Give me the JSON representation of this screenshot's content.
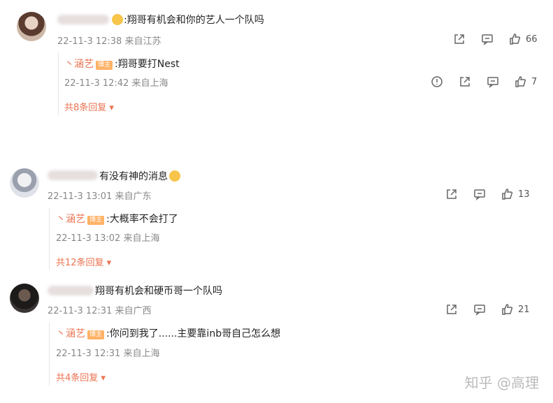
{
  "comments": [
    {
      "text": ":翔哥有机会和你的艺人一个队吗",
      "meta": "22-11-3 12:38 来自江苏",
      "likes": "66",
      "reply": {
        "name": "丶涵艺",
        "badge": "博主",
        "text": ":翔哥要打Nest",
        "meta": "22-11-3 12:42 来自上海",
        "likes": "7"
      },
      "more": "共8条回复"
    },
    {
      "text": "有没有神的消息",
      "meta": "22-11-3 13:01 来自广东",
      "likes": "13",
      "reply": {
        "name": "丶涵艺",
        "badge": "博主",
        "text": ":大概率不会打了",
        "meta": "22-11-3 13:02 来自上海"
      },
      "more": "共12条回复"
    },
    {
      "text": "翔哥有机会和硬币哥一个队吗",
      "meta": "22-11-3 12:31 来自广西",
      "likes": "21",
      "reply": {
        "name": "丶涵艺",
        "badge": "博主",
        "text": ":你问到我了......主要靠inb哥自己怎么想",
        "meta": "22-11-3 12:31 来自上海"
      },
      "more": "共4条回复"
    }
  ],
  "icons": {
    "share": "share-icon",
    "comment": "comment-icon",
    "like": "thumb-up-icon",
    "report": "report-icon",
    "chevron": "chevron-down-icon"
  },
  "colors": {
    "reply_name": "#eb7350",
    "badge_bg": "#ffb266",
    "meta": "#888888"
  },
  "watermark": "知乎 @高理"
}
